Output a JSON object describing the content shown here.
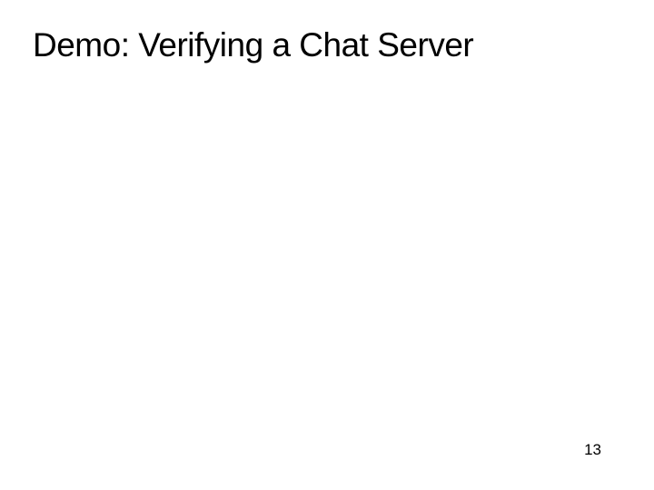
{
  "slide": {
    "title": "Demo: Verifying a Chat Server",
    "page_number": "13"
  }
}
